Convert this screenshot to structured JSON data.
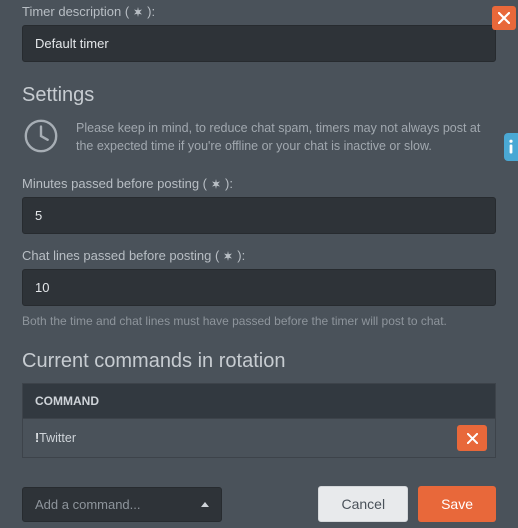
{
  "timer_desc_label_pre": "Timer description (",
  "timer_desc_label_post": "):",
  "timer_desc_value": "Default timer",
  "settings_title": "Settings",
  "settings_info": "Please keep in mind, to reduce chat spam, timers may not always post at the expected time if you're offline or your chat is inactive or slow.",
  "minutes_label_pre": "Minutes passed before posting (",
  "minutes_label_post": "):",
  "minutes_value": "5",
  "lines_label_pre": "Chat lines passed before posting (",
  "lines_label_post": "):",
  "lines_value": "10",
  "helper_text": "Both the time and chat lines must have passed before the timer will post to chat.",
  "rotation_title": "Current commands in rotation",
  "table_header": "COMMAND",
  "row_bang": "!",
  "row_cmd": "Twitter",
  "dropdown_placeholder": "Add a command...",
  "cancel_label": "Cancel",
  "save_label": "Save"
}
